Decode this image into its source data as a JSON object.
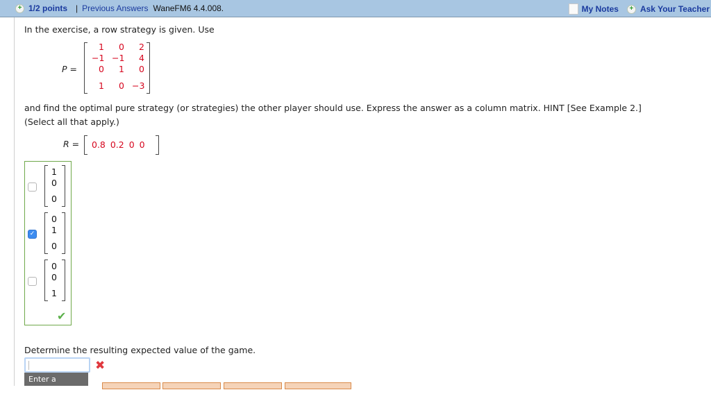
{
  "header": {
    "points": "1/2 points",
    "separator": "|",
    "previous_answers": "Previous Answers",
    "question_id": "WaneFM6 4.4.008.",
    "my_notes": "My Notes",
    "ask_teacher": "Ask Your Teacher"
  },
  "question": {
    "intro": "In the exercise, a row strategy is given. Use",
    "p_label": "P =",
    "p_matrix": [
      [
        "1",
        "0",
        "2"
      ],
      [
        "-1",
        "-1",
        "4"
      ],
      [
        "0",
        "1",
        "0"
      ],
      [
        "1",
        "0",
        "-3"
      ]
    ],
    "instruction": "and find the optimal pure strategy (or strategies) the other player should use. Express the answer as a column matrix. HINT [See Example 2.]",
    "select_all": "(Select all that apply.)",
    "r_label": "R =",
    "r_values": "0.8  0.2  0  0"
  },
  "options": [
    {
      "values": [
        "1",
        "0",
        "0"
      ],
      "checked": false
    },
    {
      "values": [
        "0",
        "1",
        "0"
      ],
      "checked": true
    },
    {
      "values": [
        "0",
        "0",
        "1"
      ],
      "checked": false
    }
  ],
  "result": "correct",
  "part2": {
    "prompt": "Determine the resulting expected value of the game.",
    "input_value": "",
    "tooltip": "Enter a number.",
    "status": "incorrect"
  },
  "colors": {
    "header_bg": "#a8c6e2",
    "link": "#1a3a9e",
    "matrix_values": "#d6061e",
    "correct_border": "#6fa84a",
    "incorrect_mark": "#e0383e"
  }
}
